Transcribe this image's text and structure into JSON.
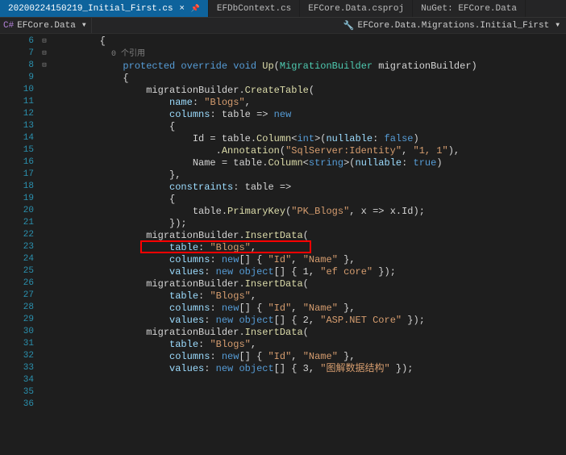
{
  "tabs": {
    "items": [
      {
        "label": "20200224150219_Initial_First.cs",
        "active": true,
        "closeable": true
      },
      {
        "label": "EFDbContext.cs",
        "active": false
      },
      {
        "label": "EFCore.Data.csproj",
        "active": false
      },
      {
        "label": "NuGet: EFCore.Data",
        "active": false
      }
    ]
  },
  "breadcrumb": {
    "left": "EFCore.Data",
    "right": "EFCore.Data.Migrations.Initial_First"
  },
  "codelens": "0 个引用",
  "lines": [
    {
      "n": 6,
      "fold": "",
      "t": [
        {
          "c": "op",
          "v": "        {"
        }
      ]
    },
    {
      "n": null,
      "fold": "",
      "t": [
        {
          "c": "codelens",
          "v": "            "
        },
        {
          "c": "codelens",
          "v": "0 个引用"
        }
      ],
      "lens": true
    },
    {
      "n": 7,
      "fold": "⊟",
      "t": [
        {
          "c": "op",
          "v": "            "
        },
        {
          "c": "kw",
          "v": "protected override void"
        },
        {
          "c": "op",
          "v": " "
        },
        {
          "c": "fn",
          "v": "Up"
        },
        {
          "c": "op",
          "v": "("
        },
        {
          "c": "type",
          "v": "MigrationBuilder"
        },
        {
          "c": "op",
          "v": " migrationBuilder)"
        }
      ]
    },
    {
      "n": 8,
      "fold": "",
      "t": [
        {
          "c": "op",
          "v": "            {"
        }
      ]
    },
    {
      "n": 9,
      "fold": "⊟",
      "t": [
        {
          "c": "op",
          "v": "                migrationBuilder."
        },
        {
          "c": "fn",
          "v": "CreateTable"
        },
        {
          "c": "op",
          "v": "("
        }
      ]
    },
    {
      "n": 10,
      "fold": "",
      "t": [
        {
          "c": "op",
          "v": "                    "
        },
        {
          "c": "param",
          "v": "name"
        },
        {
          "c": "op",
          "v": ": "
        },
        {
          "c": "str",
          "v": "\"Blogs\""
        },
        {
          "c": "op",
          "v": ","
        }
      ]
    },
    {
      "n": 11,
      "fold": "",
      "t": [
        {
          "c": "op",
          "v": "                    "
        },
        {
          "c": "param",
          "v": "columns"
        },
        {
          "c": "op",
          "v": ": table => "
        },
        {
          "c": "kw",
          "v": "new"
        }
      ]
    },
    {
      "n": 12,
      "fold": "",
      "t": [
        {
          "c": "op",
          "v": "                    {"
        }
      ]
    },
    {
      "n": 13,
      "fold": "",
      "t": [
        {
          "c": "op",
          "v": "                        Id = table."
        },
        {
          "c": "fn",
          "v": "Column"
        },
        {
          "c": "op",
          "v": "<"
        },
        {
          "c": "vartype",
          "v": "int"
        },
        {
          "c": "op",
          "v": ">("
        },
        {
          "c": "param",
          "v": "nullable"
        },
        {
          "c": "op",
          "v": ": "
        },
        {
          "c": "kw",
          "v": "false"
        },
        {
          "c": "op",
          "v": ")"
        }
      ]
    },
    {
      "n": 14,
      "fold": "",
      "t": [
        {
          "c": "op",
          "v": "                            ."
        },
        {
          "c": "fn",
          "v": "Annotation"
        },
        {
          "c": "op",
          "v": "("
        },
        {
          "c": "str",
          "v": "\"SqlServer:Identity\""
        },
        {
          "c": "op",
          "v": ", "
        },
        {
          "c": "str",
          "v": "\"1, 1\""
        },
        {
          "c": "op",
          "v": "),"
        }
      ]
    },
    {
      "n": 15,
      "fold": "",
      "t": [
        {
          "c": "op",
          "v": "                        Name = table."
        },
        {
          "c": "fn",
          "v": "Column"
        },
        {
          "c": "op",
          "v": "<"
        },
        {
          "c": "vartype",
          "v": "string"
        },
        {
          "c": "op",
          "v": ">("
        },
        {
          "c": "param",
          "v": "nullable"
        },
        {
          "c": "op",
          "v": ": "
        },
        {
          "c": "kw",
          "v": "true"
        },
        {
          "c": "op",
          "v": ")"
        }
      ]
    },
    {
      "n": 16,
      "fold": "",
      "t": [
        {
          "c": "op",
          "v": "                    },"
        }
      ]
    },
    {
      "n": 17,
      "fold": "⊟",
      "t": [
        {
          "c": "op",
          "v": "                    "
        },
        {
          "c": "param",
          "v": "constraints"
        },
        {
          "c": "op",
          "v": ": table =>"
        }
      ]
    },
    {
      "n": 18,
      "fold": "",
      "t": [
        {
          "c": "op",
          "v": "                    {"
        }
      ]
    },
    {
      "n": 19,
      "fold": "",
      "t": [
        {
          "c": "op",
          "v": "                        table."
        },
        {
          "c": "fn",
          "v": "PrimaryKey"
        },
        {
          "c": "op",
          "v": "("
        },
        {
          "c": "str",
          "v": "\"PK_Blogs\""
        },
        {
          "c": "op",
          "v": ", x => x.Id);"
        }
      ]
    },
    {
      "n": 20,
      "fold": "",
      "t": [
        {
          "c": "op",
          "v": "                    });"
        }
      ]
    },
    {
      "n": 21,
      "fold": "",
      "t": [
        {
          "c": "op",
          "v": ""
        }
      ]
    },
    {
      "n": 22,
      "fold": "",
      "t": [
        {
          "c": "op",
          "v": "                migrationBuilder."
        },
        {
          "c": "fn",
          "v": "InsertData"
        },
        {
          "c": "op",
          "v": "("
        }
      ],
      "hl": true
    },
    {
      "n": 23,
      "fold": "",
      "t": [
        {
          "c": "op",
          "v": "                    "
        },
        {
          "c": "param",
          "v": "table"
        },
        {
          "c": "op",
          "v": ": "
        },
        {
          "c": "str",
          "v": "\"Blogs\""
        },
        {
          "c": "op",
          "v": ","
        }
      ]
    },
    {
      "n": 24,
      "fold": "",
      "t": [
        {
          "c": "op",
          "v": "                    "
        },
        {
          "c": "param",
          "v": "columns"
        },
        {
          "c": "op",
          "v": ": "
        },
        {
          "c": "kw",
          "v": "new"
        },
        {
          "c": "op",
          "v": "[] { "
        },
        {
          "c": "str",
          "v": "\"Id\""
        },
        {
          "c": "op",
          "v": ", "
        },
        {
          "c": "str",
          "v": "\"Name\""
        },
        {
          "c": "op",
          "v": " },"
        }
      ]
    },
    {
      "n": 25,
      "fold": "",
      "t": [
        {
          "c": "op",
          "v": "                    "
        },
        {
          "c": "param",
          "v": "values"
        },
        {
          "c": "op",
          "v": ": "
        },
        {
          "c": "kw",
          "v": "new object"
        },
        {
          "c": "op",
          "v": "[] { 1, "
        },
        {
          "c": "str",
          "v": "\"ef core\""
        },
        {
          "c": "op",
          "v": " });"
        }
      ]
    },
    {
      "n": 26,
      "fold": "",
      "t": [
        {
          "c": "op",
          "v": ""
        }
      ]
    },
    {
      "n": 27,
      "fold": "",
      "t": [
        {
          "c": "op",
          "v": "                migrationBuilder."
        },
        {
          "c": "fn",
          "v": "InsertData"
        },
        {
          "c": "op",
          "v": "("
        }
      ]
    },
    {
      "n": 28,
      "fold": "",
      "t": [
        {
          "c": "op",
          "v": "                    "
        },
        {
          "c": "param",
          "v": "table"
        },
        {
          "c": "op",
          "v": ": "
        },
        {
          "c": "str",
          "v": "\"Blogs\""
        },
        {
          "c": "op",
          "v": ","
        }
      ]
    },
    {
      "n": 29,
      "fold": "",
      "t": [
        {
          "c": "op",
          "v": "                    "
        },
        {
          "c": "param",
          "v": "columns"
        },
        {
          "c": "op",
          "v": ": "
        },
        {
          "c": "kw",
          "v": "new"
        },
        {
          "c": "op",
          "v": "[] { "
        },
        {
          "c": "str",
          "v": "\"Id\""
        },
        {
          "c": "op",
          "v": ", "
        },
        {
          "c": "str",
          "v": "\"Name\""
        },
        {
          "c": "op",
          "v": " },"
        }
      ]
    },
    {
      "n": 30,
      "fold": "",
      "t": [
        {
          "c": "op",
          "v": "                    "
        },
        {
          "c": "param",
          "v": "values"
        },
        {
          "c": "op",
          "v": ": "
        },
        {
          "c": "kw",
          "v": "new object"
        },
        {
          "c": "op",
          "v": "[] { 2, "
        },
        {
          "c": "str",
          "v": "\"ASP.NET Core\""
        },
        {
          "c": "op",
          "v": " });"
        }
      ]
    },
    {
      "n": 31,
      "fold": "",
      "t": [
        {
          "c": "op",
          "v": ""
        }
      ]
    },
    {
      "n": 32,
      "fold": "",
      "t": [
        {
          "c": "op",
          "v": "                migrationBuilder."
        },
        {
          "c": "fn",
          "v": "InsertData"
        },
        {
          "c": "op",
          "v": "("
        }
      ]
    },
    {
      "n": 33,
      "fold": "",
      "t": [
        {
          "c": "op",
          "v": "                    "
        },
        {
          "c": "param",
          "v": "table"
        },
        {
          "c": "op",
          "v": ": "
        },
        {
          "c": "str",
          "v": "\"Blogs\""
        },
        {
          "c": "op",
          "v": ","
        }
      ]
    },
    {
      "n": 34,
      "fold": "",
      "t": [
        {
          "c": "op",
          "v": "                    "
        },
        {
          "c": "param",
          "v": "columns"
        },
        {
          "c": "op",
          "v": ": "
        },
        {
          "c": "kw",
          "v": "new"
        },
        {
          "c": "op",
          "v": "[] { "
        },
        {
          "c": "str",
          "v": "\"Id\""
        },
        {
          "c": "op",
          "v": ", "
        },
        {
          "c": "str",
          "v": "\"Name\""
        },
        {
          "c": "op",
          "v": " },"
        }
      ]
    },
    {
      "n": 35,
      "fold": "",
      "t": [
        {
          "c": "op",
          "v": "                    "
        },
        {
          "c": "param",
          "v": "values"
        },
        {
          "c": "op",
          "v": ": "
        },
        {
          "c": "kw",
          "v": "new object"
        },
        {
          "c": "op",
          "v": "[] { 3, "
        },
        {
          "c": "str",
          "v": "\"图解数据结构\""
        },
        {
          "c": "op",
          "v": " });"
        }
      ]
    },
    {
      "n": 36,
      "fold": "",
      "t": [
        {
          "c": "op",
          "v": ""
        }
      ]
    }
  ]
}
